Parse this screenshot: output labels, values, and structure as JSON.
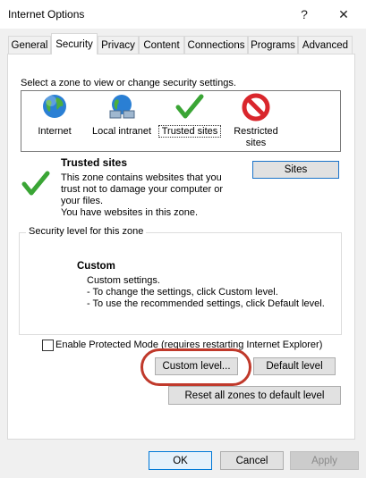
{
  "window": {
    "title": "Internet Options",
    "help_glyph": "?",
    "close_glyph": "✕"
  },
  "tabs": [
    {
      "label": "General"
    },
    {
      "label": "Security"
    },
    {
      "label": "Privacy"
    },
    {
      "label": "Content"
    },
    {
      "label": "Connections"
    },
    {
      "label": "Programs"
    },
    {
      "label": "Advanced"
    }
  ],
  "zones": {
    "prompt": "Select a zone to view or change security settings.",
    "items": [
      {
        "label": "Internet",
        "icon": "globe-icon"
      },
      {
        "label": "Local intranet",
        "icon": "network-globe-icon"
      },
      {
        "label": "Trusted sites",
        "icon": "checkmark-icon"
      },
      {
        "label": "Restricted sites",
        "icon": "restricted-icon"
      }
    ],
    "selected": "Trusted sites"
  },
  "zone_info": {
    "title": "Trusted sites",
    "description": "This zone contains websites that you trust not to damage your computer or your files.",
    "status": "You have websites in this zone.",
    "sites_button": "Sites"
  },
  "security_level": {
    "group_label": "Security level for this zone",
    "level_title": "Custom",
    "line1": "Custom settings.",
    "line2": "- To change the settings, click Custom level.",
    "line3": "- To use the recommended settings, click Default level."
  },
  "protected_mode": {
    "label": "Enable Protected Mode (requires restarting Internet Explorer)",
    "checked": false
  },
  "buttons": {
    "custom_level": "Custom level...",
    "default_level": "Default level",
    "reset_all": "Reset all zones to default level",
    "ok": "OK",
    "cancel": "Cancel",
    "apply": "Apply"
  },
  "colors": {
    "highlight_annotation": "#c0392b",
    "focus_border": "#0078d7",
    "trusted_check": "#3aa535",
    "restricted_red": "#d9262c"
  }
}
